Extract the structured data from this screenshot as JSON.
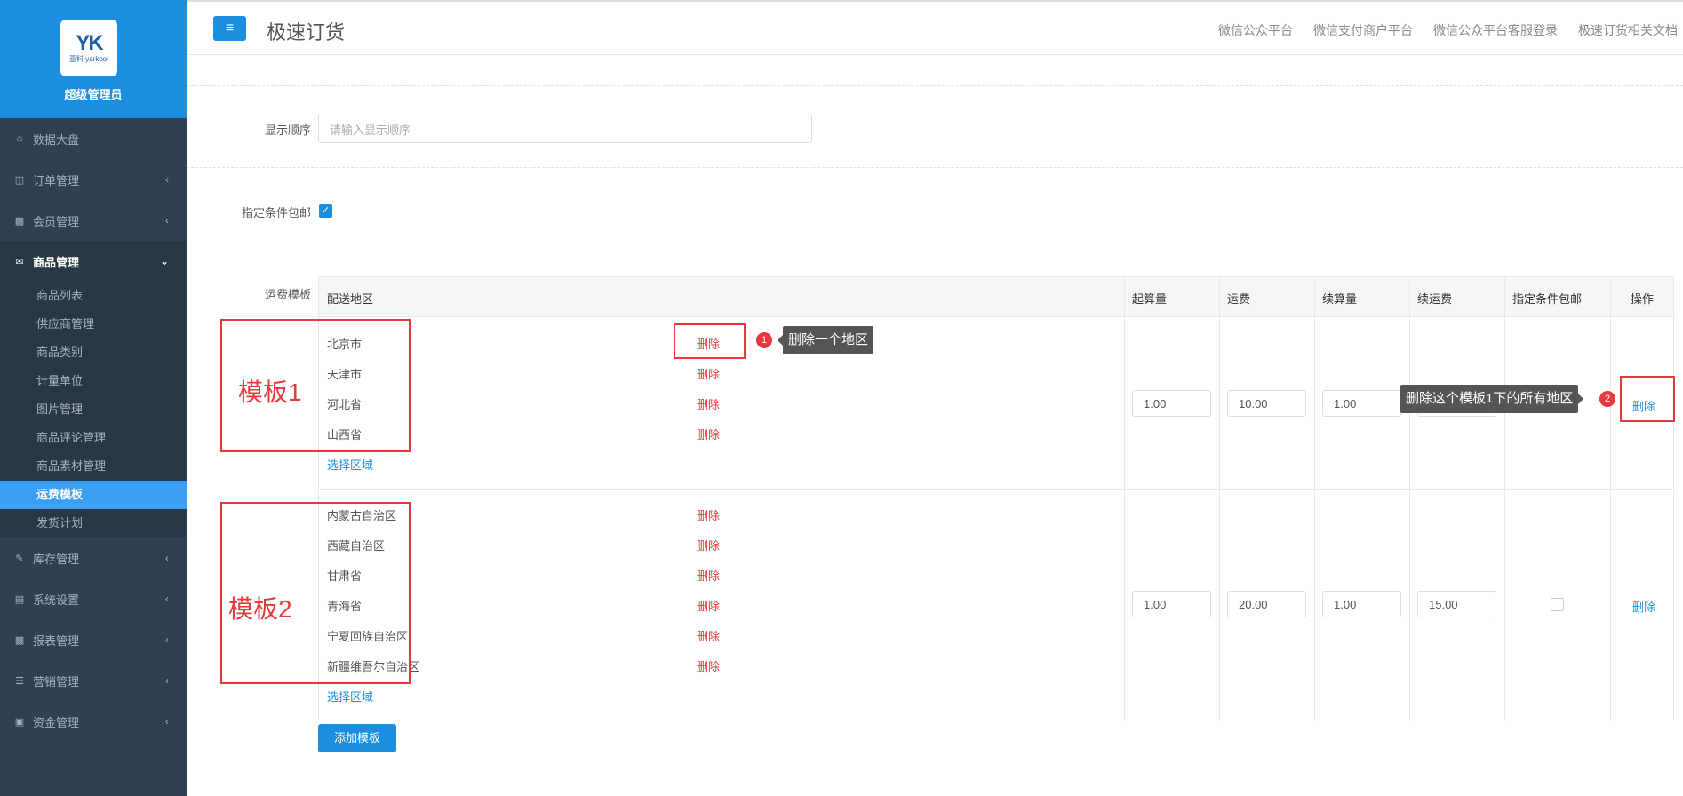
{
  "sidebar": {
    "logo_mark": "YK",
    "logo_text": "亚科 yarkool",
    "role": "超级管理员",
    "items": [
      {
        "label": "数据大盘",
        "icon": "home-icon"
      },
      {
        "label": "订单管理",
        "icon": "columns-icon"
      },
      {
        "label": "会员管理",
        "icon": "bar-chart-icon"
      },
      {
        "label": "商品管理",
        "icon": "envelope-icon"
      },
      {
        "label": "库存管理",
        "icon": "edit-icon"
      },
      {
        "label": "系统设置",
        "icon": "desktop-icon"
      },
      {
        "label": "报表管理",
        "icon": "bar-chart-icon"
      },
      {
        "label": "营销管理",
        "icon": "cutlery-icon"
      },
      {
        "label": "资金管理",
        "icon": "money-icon"
      }
    ],
    "sub_items": [
      "商品列表",
      "供应商管理",
      "商品类别",
      "计量单位",
      "图片管理",
      "商品评论管理",
      "商品素材管理",
      "运费模板",
      "发货计划"
    ]
  },
  "header": {
    "title": "极速订货",
    "links": [
      "微信公众平台",
      "微信支付商户平台",
      "微信公众平台客服登录",
      "极速订货相关文档"
    ]
  },
  "form": {
    "order_label": "显示顺序",
    "order_placeholder": "请输入显示顺序",
    "free_shipping_label": "指定条件包邮",
    "template_label": "运费模板"
  },
  "table": {
    "headers": [
      "配送地区",
      "起算量",
      "运费",
      "续算量",
      "续运费",
      "指定条件包邮",
      "操作"
    ],
    "delete_label": "删除",
    "select_region_label": "选择区域",
    "templates": [
      {
        "name": "模板1",
        "regions": [
          "北京市",
          "天津市",
          "河北省",
          "山西省"
        ],
        "start_qty": "1.00",
        "fee": "10.00",
        "extra_qty": "1.00",
        "extra_fee": ""
      },
      {
        "name": "模板2",
        "regions": [
          "内蒙古自治区",
          "西藏自治区",
          "甘肃省",
          "青海省",
          "宁夏回族自治区",
          "新疆维吾尔自治区"
        ],
        "start_qty": "1.00",
        "fee": "20.00",
        "extra_qty": "1.00",
        "extra_fee": "15.00"
      }
    ]
  },
  "annotations": {
    "tip1_num": "1",
    "tip1": "删除一个地区",
    "tip2_num": "2",
    "tip2": "删除这个模板1下的所有地区"
  },
  "add_template_label": "添加模板",
  "colors": {
    "primary": "#1c8ee0",
    "sidebar": "#2f4050",
    "danger": "#e8383d"
  }
}
